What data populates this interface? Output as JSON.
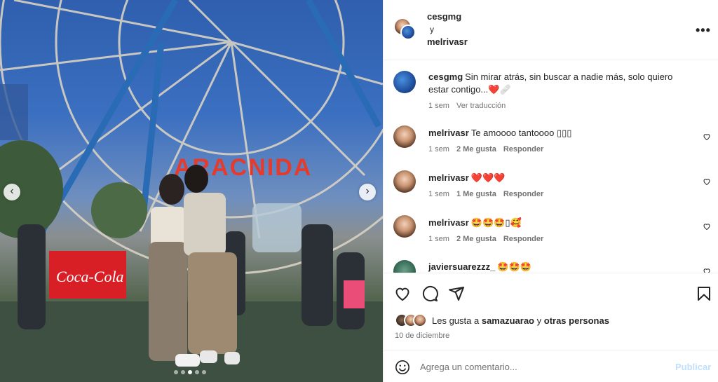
{
  "post": {
    "authors": [
      "cesgmg",
      "melrivasr"
    ],
    "connector": "y",
    "photo": {
      "sign_text": "ARACNIDA",
      "banner_text": "Coca-Cola",
      "slide_count": 5,
      "active_slide": 3
    }
  },
  "comments": [
    {
      "user": "cesgmg",
      "text": "Sin mirar atrás, sin buscar a nadie más, solo quiero estar contigo...❤️🩹",
      "time": "1 sem",
      "likes": "",
      "reply": "",
      "extra": "Ver traducción",
      "is_caption": true
    },
    {
      "user": "melrivasr",
      "text": "Te amoooo tantoooo ▯▯▯",
      "time": "1 sem",
      "likes": "2 Me gusta",
      "reply": "Responder"
    },
    {
      "user": "melrivasr",
      "text": "❤️❤️❤️",
      "time": "1 sem",
      "likes": "1 Me gusta",
      "reply": "Responder"
    },
    {
      "user": "melrivasr",
      "text": "🤩🤩🤩▯🥰",
      "time": "1 sem",
      "likes": "2 Me gusta",
      "reply": "Responder"
    },
    {
      "user": "javiersuarezzz_",
      "text": "🤩🤩🤩",
      "time": "",
      "likes": "",
      "reply": ""
    }
  ],
  "likes": {
    "prefix": "Les gusta a",
    "user": "samazuarao",
    "middle": "y",
    "others": "otras personas"
  },
  "date": "10 de diciembre",
  "add_comment": {
    "placeholder": "Agrega un comentario...",
    "publish_label": "Publicar"
  },
  "colors": {
    "accent_disabled": "#c0dffd",
    "text": "#262626",
    "secondary_text": "#737373",
    "heart_red": "#ed4956"
  },
  "icons": [
    "more-icon",
    "heart-icon",
    "comment-icon",
    "share-icon",
    "bookmark-icon",
    "emoji-icon",
    "chevron-left-icon",
    "chevron-right-icon"
  ]
}
